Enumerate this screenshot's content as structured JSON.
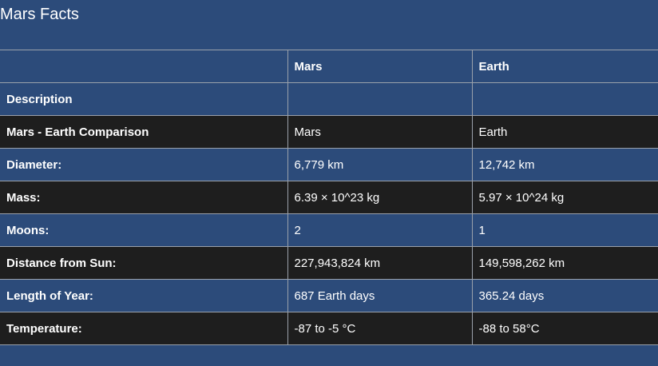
{
  "page": {
    "title": "Mars Facts"
  },
  "table": {
    "headers": [
      "",
      "Mars",
      "Earth"
    ],
    "section_label": "Description",
    "rows": [
      {
        "label": "Mars - Earth Comparison",
        "mars": "Mars",
        "earth": "Earth"
      },
      {
        "label": "Diameter:",
        "mars": "6,779 km",
        "earth": "12,742 km"
      },
      {
        "label": "Mass:",
        "mars": "6.39 × 10^23 kg",
        "earth": "5.97 × 10^24 kg"
      },
      {
        "label": "Moons:",
        "mars": "2",
        "earth": "1"
      },
      {
        "label": "Distance from Sun:",
        "mars": "227,943,824 km",
        "earth": "149,598,262 km"
      },
      {
        "label": "Length of Year:",
        "mars": "687 Earth days",
        "earth": "365.24 days"
      },
      {
        "label": "Temperature:",
        "mars": "-87 to -5 °C",
        "earth": "-88 to 58°C"
      }
    ]
  },
  "colors": {
    "background": "#2c4b7a",
    "dark_row": "#1e1e1e",
    "text": "#ffffff",
    "border": "#9aa1ab"
  }
}
